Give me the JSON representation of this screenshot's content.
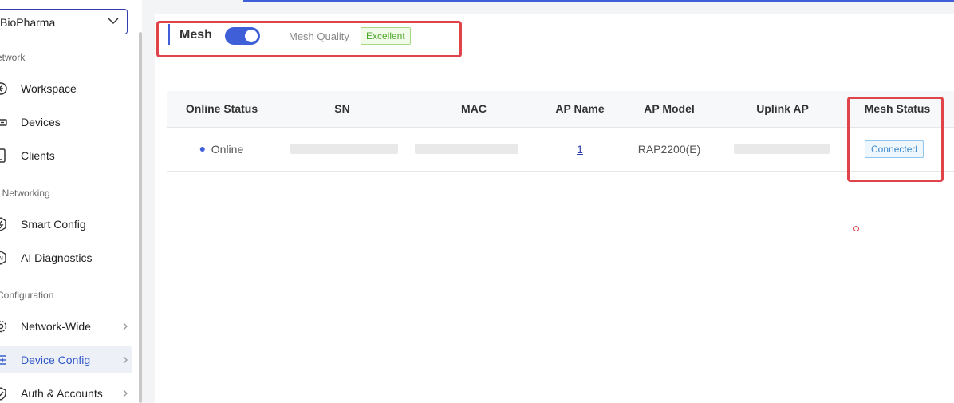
{
  "sidebar": {
    "org_select": "BioPharma",
    "sections": {
      "network": "etwork",
      "ai_networking": "I Networking",
      "configuration": "Configuration"
    },
    "items": [
      {
        "label": "Workspace",
        "icon": "workspace-icon"
      },
      {
        "label": "Devices",
        "icon": "devices-icon"
      },
      {
        "label": "Clients",
        "icon": "clients-icon"
      },
      {
        "label": "Smart Config",
        "icon": "smart-config-icon"
      },
      {
        "label": "AI Diagnostics",
        "icon": "ai-diagnostics-icon"
      },
      {
        "label": "Network-Wide",
        "icon": "gear-icon"
      },
      {
        "label": "Device Config",
        "icon": "sliders-icon",
        "active": true
      },
      {
        "label": "Auth & Accounts",
        "icon": "shield-icon"
      }
    ]
  },
  "mesh": {
    "title": "Mesh",
    "enabled": true,
    "quality_label": "Mesh Quality",
    "quality_value": "Excellent"
  },
  "table": {
    "columns": [
      "Online Status",
      "SN",
      "MAC",
      "AP Name",
      "AP Model",
      "Uplink AP",
      "Mesh Status"
    ],
    "rows": [
      {
        "online_status": "Online",
        "sn": "",
        "mac": "",
        "ap_name": "1",
        "ap_model": "RAP2200(E)",
        "uplink_ap": "",
        "mesh_status": "Connected"
      }
    ]
  },
  "colors": {
    "accent": "#3e5fd8",
    "highlight": "#e0434a",
    "success": "#4ca72b",
    "connected": "#3b87c8"
  }
}
